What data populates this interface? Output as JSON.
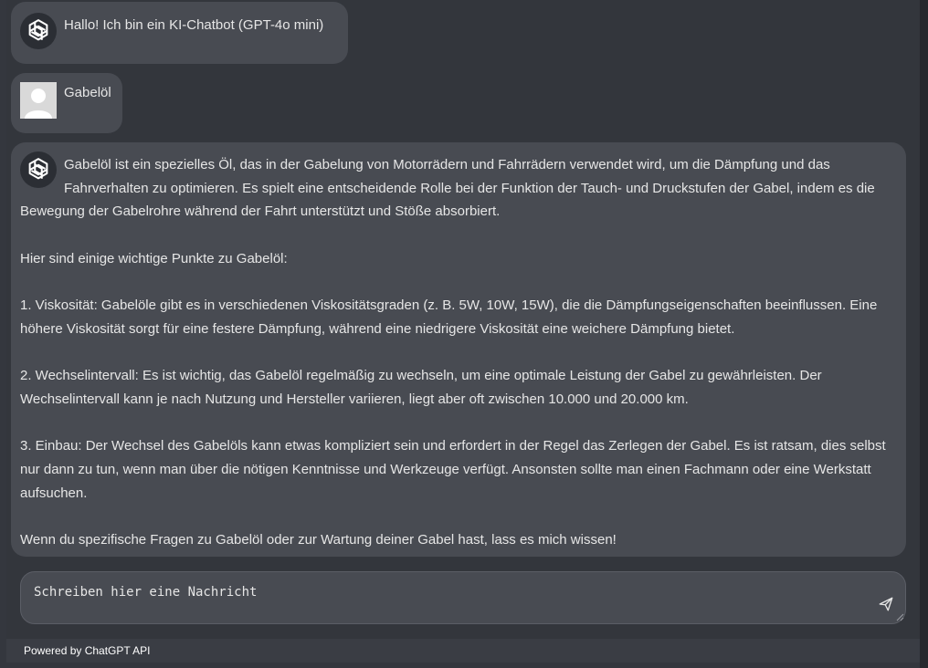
{
  "messages": [
    {
      "role": "assistant",
      "avatar_icon": "openai-logo-icon",
      "text": "Hallo! Ich bin ein KI-Chatbot (GPT-4o mini)"
    },
    {
      "role": "user",
      "avatar_icon": "user-silhouette-icon",
      "text": "Gabelöl"
    },
    {
      "role": "assistant",
      "avatar_icon": "openai-logo-icon",
      "paragraphs": [
        "Gabelöl ist ein spezielles Öl, das in der Gabelung von Motorrädern und Fahrrädern verwendet wird, um die Dämpfung und das Fahrverhalten zu optimieren. Es spielt eine entscheidende Rolle bei der Funktion der Tauch- und Druckstufen der Gabel, indem es die Bewegung der Gabelrohre während der Fahrt unterstützt und Stöße absorbiert.",
        "Hier sind einige wichtige Punkte zu Gabelöl:",
        "1. Viskosität: Gabelöle gibt es in verschiedenen Viskositätsgraden (z. B. 5W, 10W, 15W), die die Dämpfungseigenschaften beeinflussen. Eine höhere Viskosität sorgt für eine festere Dämpfung, während eine niedrigere Viskosität eine weichere Dämpfung bietet.",
        "2. Wechselintervall: Es ist wichtig, das Gabelöl regelmäßig zu wechseln, um eine optimale Leistung der Gabel zu gewährleisten. Der Wechselintervall kann je nach Nutzung und Hersteller variieren, liegt aber oft zwischen 10.000 und 20.000 km.",
        "3. Einbau: Der Wechsel des Gabelöls kann etwas kompliziert sein und erfordert in der Regel das Zerlegen der Gabel. Es ist ratsam, dies selbst nur dann zu tun, wenn man über die nötigen Kenntnisse und Werkzeuge verfügt. Ansonsten sollte man einen Fachmann oder eine Werkstatt aufsuchen.",
        "Wenn du spezifische Fragen zu Gabelöl oder zur Wartung deiner Gabel hast, lass es mich wissen!"
      ]
    }
  ],
  "input": {
    "placeholder": "Schreiben hier eine Nachricht",
    "value": "",
    "send_icon": "send-icon"
  },
  "footer": {
    "text": "Powered by ChatGPT API"
  },
  "colors": {
    "background": "#33363c",
    "bubble": "#484b52",
    "text": "#e6e6e6"
  }
}
